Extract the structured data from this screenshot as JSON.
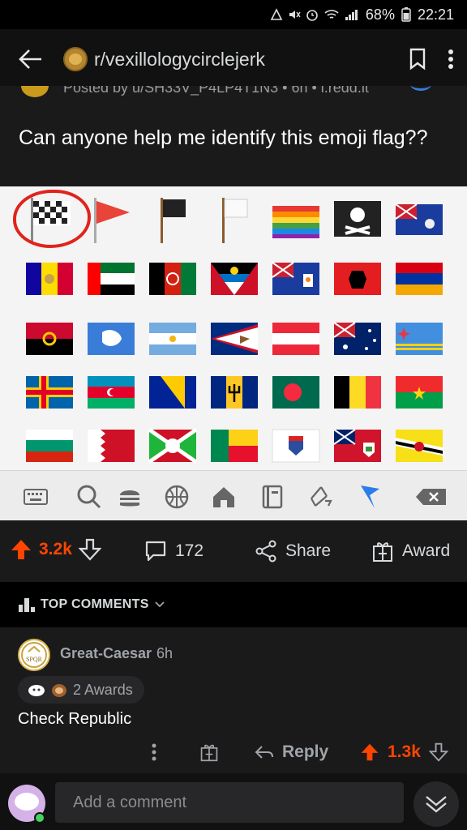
{
  "status_bar": {
    "battery": "68%",
    "time": "22:21",
    "icons": [
      "alarm-icon",
      "mute-icon",
      "clock-icon",
      "wifi-icon",
      "signal-icon",
      "battery-icon"
    ]
  },
  "header": {
    "subreddit": "r/vexillologycirclejerk",
    "icons": [
      "back-arrow-icon",
      "bookmark-icon",
      "more-vertical-icon"
    ]
  },
  "post": {
    "posted_by": "Posted by u/SH33V_P4LP4T1N3 • 6h • i.redd.it",
    "title": "Can anyone help me identify this emoji flag??"
  },
  "image": {
    "flags": [
      [
        "chequered",
        "triangular-red",
        "black",
        "white",
        "rainbow",
        "pirate",
        "ascension-island"
      ],
      [
        "andorra",
        "uae",
        "afghanistan",
        "antigua-barbuda",
        "anguilla",
        "albania",
        "armenia"
      ],
      [
        "angola",
        "antarctica",
        "argentina",
        "american-samoa",
        "austria",
        "australia",
        "aruba"
      ],
      [
        "aland",
        "azerbaijan",
        "bosnia",
        "barbados",
        "bangladesh",
        "belgium",
        "burkina-faso"
      ],
      [
        "bulgaria",
        "bahrain",
        "burundi",
        "benin",
        "st-barthelemy",
        "bermuda",
        "brunei"
      ]
    ],
    "keyboard_icons": [
      "keyboard-icon",
      "search-icon",
      "food-icon",
      "sports-icon",
      "home-icon",
      "book-icon",
      "recycle-icon",
      "flag-icon",
      "backspace-icon"
    ],
    "accent_colors": {
      "circle": "#e0241c",
      "flag_tab": "#2b7de9"
    }
  },
  "actions": {
    "upvotes": "3.2k",
    "comments": "172",
    "share": "Share",
    "award": "Award"
  },
  "sort": {
    "label": "TOP COMMENTS"
  },
  "comment": {
    "author": "Great-Caesar",
    "time": "6h",
    "awards": "2 Awards",
    "text": "Check Republic",
    "reply": "Reply",
    "upvotes": "1.3k",
    "avatar_text": "SPQR"
  },
  "composer": {
    "placeholder": "Add a comment"
  },
  "colors": {
    "upvote": "#ff4500",
    "background": "#1a1a1b",
    "online": "#46d160"
  }
}
